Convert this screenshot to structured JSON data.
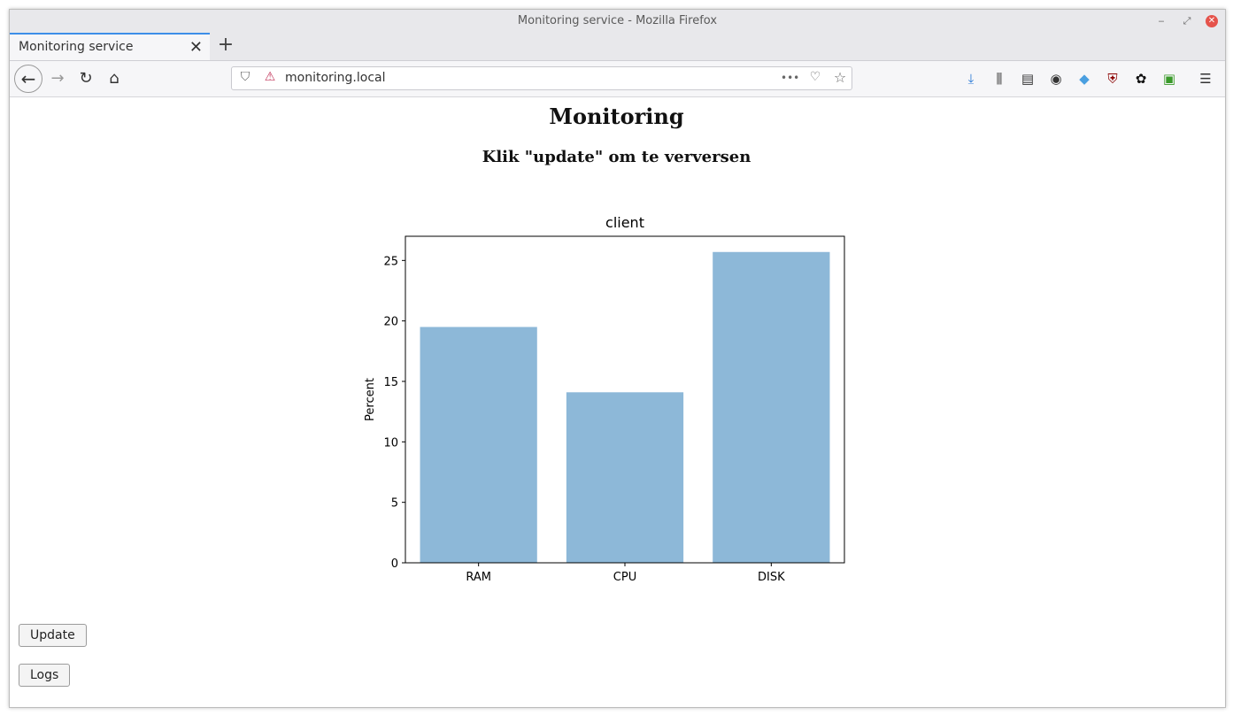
{
  "window": {
    "title": "Monitoring service - Mozilla Firefox",
    "minimize": "‒",
    "restore": "⤢",
    "close": "✕"
  },
  "tabs": [
    {
      "label": "Monitoring service",
      "close": "✕"
    }
  ],
  "newtab_label": "+",
  "nav": {
    "back": "←",
    "forward": "→",
    "reload": "↻",
    "home": "⌂"
  },
  "urlbar": {
    "url": "monitoring.local",
    "shield": "⛉",
    "insecure": "⚠",
    "more": "•••",
    "pocket": "♡",
    "star": "☆"
  },
  "toolbar": {
    "downloads": "⤓",
    "library": "⫼",
    "sidebar": "▤",
    "account": "◉",
    "ext1": "◆",
    "ext2": "⛨",
    "ext3": "✿",
    "ext4": "▣",
    "menu": "☰",
    "downloads_color": "#2a7ad6"
  },
  "page": {
    "heading": "Monitoring",
    "subheading": "Klik \"update\" om te verversen"
  },
  "chart_data": {
    "type": "bar",
    "title": "client",
    "xlabel": "",
    "ylabel": "Percent",
    "categories": [
      "RAM",
      "CPU",
      "DISK"
    ],
    "values": [
      19.5,
      14.1,
      25.7
    ],
    "ylim": [
      0,
      27
    ],
    "yticks": [
      0,
      5,
      10,
      15,
      20,
      25
    ],
    "bar_color": "#8db8d8",
    "grid": false
  },
  "buttons": {
    "update": "Update",
    "logs": "Logs"
  }
}
